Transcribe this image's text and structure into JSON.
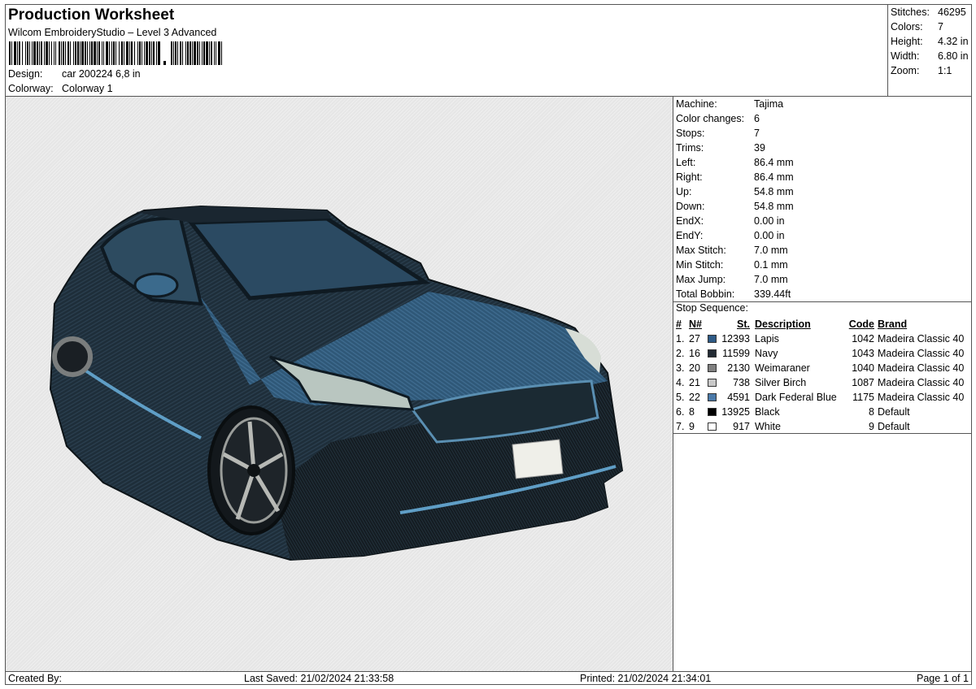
{
  "header": {
    "title": "Production Worksheet",
    "subtitle": "Wilcom EmbroideryStudio – Level 3 Advanced",
    "design_label": "Design:",
    "design_value": "car 200224 6,8 in",
    "colorway_label": "Colorway:",
    "colorway_value": "Colorway 1"
  },
  "stats": [
    {
      "label": "Stitches:",
      "value": "46295"
    },
    {
      "label": "Colors:",
      "value": "7"
    },
    {
      "label": "Height:",
      "value": "4.32 in"
    },
    {
      "label": "Width:",
      "value": "6.80 in"
    },
    {
      "label": "Zoom:",
      "value": "1:1"
    }
  ],
  "machine_info": [
    {
      "label": "Machine:",
      "value": "Tajima"
    },
    {
      "label": "Color changes:",
      "value": "6"
    },
    {
      "label": "Stops:",
      "value": "7"
    },
    {
      "label": "Trims:",
      "value": "39"
    },
    {
      "label": "Left:",
      "value": "86.4 mm"
    },
    {
      "label": "Right:",
      "value": "86.4 mm"
    },
    {
      "label": "Up:",
      "value": "54.8 mm"
    },
    {
      "label": "Down:",
      "value": "54.8 mm"
    },
    {
      "label": "EndX:",
      "value": "0.00 in"
    },
    {
      "label": "EndY:",
      "value": "0.00 in"
    },
    {
      "label": "Max Stitch:",
      "value": "7.0 mm"
    },
    {
      "label": "Min Stitch:",
      "value": "0.1 mm"
    },
    {
      "label": "Max Jump:",
      "value": "7.0 mm"
    },
    {
      "label": "Total Bobbin:",
      "value": "339.44ft"
    }
  ],
  "stop_sequence": {
    "title": "Stop Sequence:",
    "headers": {
      "num": "#",
      "n": "N#",
      "st": "St.",
      "desc": "Description",
      "code": "Code",
      "brand": "Brand"
    },
    "rows": [
      {
        "idx": "1.",
        "n": "27",
        "color": "#2e5a86",
        "st": "12393",
        "desc": "Lapis",
        "code": "1042",
        "brand": "Madeira Classic 40"
      },
      {
        "idx": "2.",
        "n": "16",
        "color": "#222a33",
        "st": "11599",
        "desc": "Navy",
        "code": "1043",
        "brand": "Madeira Classic 40"
      },
      {
        "idx": "3.",
        "n": "20",
        "color": "#808080",
        "st": "2130",
        "desc": "Weimaraner",
        "code": "1040",
        "brand": "Madeira Classic 40"
      },
      {
        "idx": "4.",
        "n": "21",
        "color": "#c8c8c8",
        "st": "738",
        "desc": "Silver Birch",
        "code": "1087",
        "brand": "Madeira Classic 40"
      },
      {
        "idx": "5.",
        "n": "22",
        "color": "#4a79a8",
        "st": "4591",
        "desc": "Dark Federal Blue",
        "code": "1175",
        "brand": "Madeira Classic 40"
      },
      {
        "idx": "6.",
        "n": "8",
        "color": "#000000",
        "st": "13925",
        "desc": "Black",
        "code": "8",
        "brand": "Default"
      },
      {
        "idx": "7.",
        "n": "9",
        "color": "#ffffff",
        "st": "917",
        "desc": "White",
        "code": "9",
        "brand": "Default"
      }
    ]
  },
  "footer": {
    "created_by": "Created By:",
    "last_saved": "Last Saved: 21/02/2024 21:33:58",
    "printed": "Printed: 21/02/2024 21:34:01",
    "page": "Page 1 of 1"
  }
}
